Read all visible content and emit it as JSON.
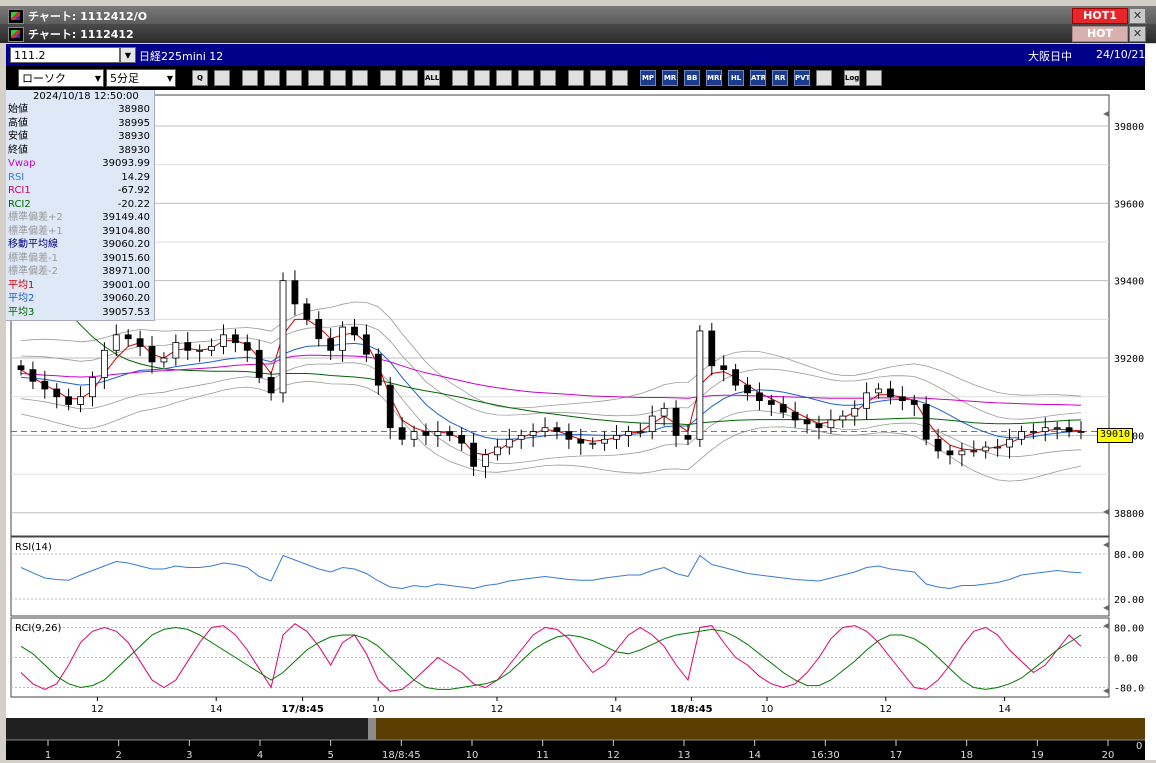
{
  "windows": {
    "outer_title": "チャート: 1112412/O",
    "inner_title": "チャート: 1112412",
    "hot_label_1": "HOT1",
    "hot_label_2": "HOT",
    "close_symbol": "✕"
  },
  "symbol_bar": {
    "code": "111.2",
    "name": "日経225mini 12",
    "market": "大阪日中",
    "date": "24/10/21"
  },
  "toolbar": {
    "chart_type": "ローソク",
    "interval": "5分足",
    "tool_icons": [
      "zoom-icon",
      "crosshair-icon",
      "pen-icon",
      "line-icon",
      "cursor-icon",
      "arrow-icon",
      "memo-icon",
      "trash-icon",
      "candle-left-icon",
      "candle-right-icon",
      "all-icon",
      "drop-icon",
      "search-chart-icon",
      "bar-chart-icon",
      "ruler-icon",
      "clock-icon",
      "gear-icon",
      "wrench-icon",
      "palette-icon",
      "mp-icon",
      "mr-icon",
      "bb-icon",
      "mre-icon",
      "hl-icon",
      "atr-icon",
      "rr-icon",
      "pvt-icon",
      "frame-icon",
      "log-icon",
      "export-icon"
    ],
    "tool_labels": [
      "Q",
      "",
      "",
      "",
      "",
      "",
      "",
      "",
      "",
      "",
      "ALL",
      "",
      "",
      "",
      "",
      "",
      "",
      "",
      "",
      "MP",
      "MR",
      "BB",
      "MRE",
      "HL",
      "ATR",
      "RR",
      "PVT",
      "",
      "Log",
      ""
    ]
  },
  "info_panel": {
    "datetime": "2024/10/18  12:50:00",
    "rows": [
      {
        "label": "始値",
        "value": "38980",
        "color": "#000000"
      },
      {
        "label": "高値",
        "value": "38995",
        "color": "#000000"
      },
      {
        "label": "安値",
        "value": "38930",
        "color": "#000000"
      },
      {
        "label": "終値",
        "value": "38930",
        "color": "#000000"
      },
      {
        "label": "Vwap",
        "value": "39093.99",
        "color": "#cc00cc"
      },
      {
        "label": "RSI",
        "value": "14.29",
        "color": "#3a7bd5"
      },
      {
        "label": "RCI1",
        "value": "-67.92",
        "color": "#cc0066"
      },
      {
        "label": "RCI2",
        "value": "-20.22",
        "color": "#006600"
      },
      {
        "label": "標準偏差+2",
        "value": "39149.40",
        "color": "#9a9a9a"
      },
      {
        "label": "標準偏差+1",
        "value": "39104.80",
        "color": "#9a9a9a"
      },
      {
        "label": "移動平均線",
        "value": "39060.20",
        "color": "#000080"
      },
      {
        "label": "標準偏差-1",
        "value": "39015.60",
        "color": "#9a9a9a"
      },
      {
        "label": "標準偏差-2",
        "value": "38971.00",
        "color": "#9a9a9a"
      },
      {
        "label": "平均1",
        "value": "39001.00",
        "color": "#cc0000"
      },
      {
        "label": "平均2",
        "value": "39060.20",
        "color": "#1f5fd0"
      },
      {
        "label": "平均3",
        "value": "39057.53",
        "color": "#006600"
      }
    ]
  },
  "price_axis": {
    "ticks": [
      "39800",
      "39600",
      "39400",
      "39200",
      "39000",
      "38800"
    ],
    "current_price_label": "39010"
  },
  "rsi_panel": {
    "title": "RSI(14)",
    "ticks": [
      "80.00",
      "20.00"
    ]
  },
  "rci_panel": {
    "title": "RCI(9,26)",
    "ticks": [
      "80.00",
      "0.00",
      "-80.00"
    ]
  },
  "time_axis": {
    "labels": [
      "12",
      "14",
      "17/8:45",
      "10",
      "12",
      "14",
      "18/8:45",
      "10",
      "12",
      "14"
    ]
  },
  "overview_axis": {
    "labels": [
      "1",
      "2",
      "3",
      "4",
      "5",
      "18/8:45",
      "10",
      "11",
      "12",
      "13",
      "14",
      "16:30",
      "17",
      "18",
      "19",
      "20"
    ],
    "right_label": "0"
  },
  "colors": {
    "vwap": "#cc00cc",
    "ma_fast": "#cc0000",
    "ma_mid": "#1f5fd0",
    "ma_slow": "#006600",
    "bands": "#9a9a9a",
    "rsi_line": "#3a7bd5",
    "rci1": "#e0006e",
    "rci2": "#007a00"
  },
  "chart_data": {
    "type": "line",
    "title": "",
    "price_range": [
      38740,
      39880
    ],
    "price_ticks": [
      38800,
      39000,
      39200,
      39400,
      39600,
      39800
    ],
    "current_price": 39010,
    "main_series": [
      {
        "name": "終値",
        "values": [
          39170,
          39140,
          39120,
          39100,
          39080,
          39100,
          39150,
          39220,
          39260,
          39250,
          39230,
          39190,
          39200,
          39240,
          39220,
          39220,
          39230,
          39260,
          39240,
          39220,
          39150,
          39110,
          39400,
          39340,
          39300,
          39250,
          39220,
          39280,
          39260,
          39210,
          39130,
          39020,
          38990,
          39010,
          39000,
          39010,
          39000,
          38980,
          38920,
          38950,
          38970,
          38990,
          39000,
          39010,
          39020,
          39010,
          38990,
          38980,
          38980,
          38990,
          39000,
          39010,
          39010,
          39050,
          39070,
          39000,
          38990,
          39270,
          39180,
          39170,
          39130,
          39110,
          39090,
          39080,
          39060,
          39040,
          39030,
          39020,
          39040,
          39050,
          39070,
          39110,
          39120,
          39100,
          39090,
          39080,
          38990,
          38960,
          38950,
          38960,
          38960,
          38970,
          38970,
          38990,
          39010,
          39010,
          39020,
          39020,
          39010,
          39010
        ]
      },
      {
        "name": "平均1",
        "values": [
          39170,
          39150,
          39130,
          39115,
          39095,
          39095,
          39115,
          39160,
          39200,
          39230,
          39240,
          39210,
          39200,
          39220,
          39225,
          39220,
          39225,
          39245,
          39245,
          39235,
          39200,
          39160,
          39260,
          39300,
          39300,
          39280,
          39250,
          39260,
          39265,
          39240,
          39180,
          39100,
          39040,
          39020,
          39010,
          39010,
          39005,
          38990,
          38955,
          38950,
          38960,
          38980,
          38995,
          39005,
          39015,
          39012,
          39000,
          38990,
          38985,
          38988,
          38995,
          39005,
          39010,
          39030,
          39050,
          39030,
          39010,
          39130,
          39160,
          39165,
          39150,
          39130,
          39110,
          39095,
          39080,
          39060,
          39045,
          39030,
          39035,
          39045,
          39060,
          39085,
          39105,
          39105,
          39098,
          39090,
          39040,
          39000,
          38975,
          38965,
          38962,
          38966,
          38970,
          38980,
          38995,
          39005,
          39012,
          39016,
          39014,
          39012
        ]
      },
      {
        "name": "平均2",
        "values": [
          39150,
          39148,
          39145,
          39140,
          39135,
          39130,
          39132,
          39140,
          39150,
          39160,
          39168,
          39170,
          39172,
          39178,
          39182,
          39186,
          39190,
          39196,
          39200,
          39202,
          39198,
          39190,
          39210,
          39222,
          39230,
          39232,
          39232,
          39236,
          39238,
          39234,
          39220,
          39190,
          39150,
          39115,
          39080,
          39055,
          39035,
          39020,
          39005,
          38995,
          38990,
          38990,
          38992,
          38995,
          38999,
          39001,
          39002,
          39002,
          39001,
          39000,
          39000,
          39002,
          39005,
          39012,
          39022,
          39025,
          39024,
          39050,
          39075,
          39095,
          39108,
          39115,
          39118,
          39116,
          39112,
          39105,
          39098,
          39090,
          39082,
          39078,
          39078,
          39082,
          39088,
          39092,
          39093,
          39092,
          39082,
          39068,
          39052,
          39035,
          39020,
          39008,
          38998,
          38994,
          38994,
          38997,
          39002,
          39006,
          39009,
          39011
        ]
      },
      {
        "name": "平均3",
        "values": [
          39480,
          39440,
          39400,
          39360,
          39320,
          39285,
          39255,
          39230,
          39210,
          39195,
          39185,
          39178,
          39172,
          39170,
          39168,
          39167,
          39166,
          39166,
          39166,
          39165,
          39162,
          39158,
          39160,
          39160,
          39160,
          39158,
          39155,
          39153,
          39151,
          39148,
          39143,
          39136,
          39128,
          39121,
          39115,
          39110,
          39104,
          39098,
          39091,
          39084,
          39078,
          39072,
          39067,
          39062,
          39058,
          39054,
          39050,
          39046,
          39042,
          39039,
          39036,
          39034,
          39032,
          39031,
          39030,
          39030,
          39028,
          39032,
          39035,
          39037,
          39039,
          39040,
          39041,
          39041,
          39041,
          39041,
          39041,
          39040,
          39040,
          39040,
          39040,
          39041,
          39042,
          39043,
          39044,
          39045,
          39044,
          39042,
          39039,
          39036,
          39033,
          39031,
          39030,
          39030,
          39031,
          39033,
          39035,
          39037,
          39039,
          39040
        ]
      },
      {
        "name": "Vwap",
        "values": [
          39160,
          39158,
          39156,
          39154,
          39152,
          39151,
          39152,
          39155,
          39158,
          39161,
          39164,
          39166,
          39167,
          39169,
          39171,
          39173,
          39175,
          39178,
          39181,
          39183,
          39184,
          39185,
          39200,
          39205,
          39207,
          39207,
          39206,
          39206,
          39205,
          39203,
          39198,
          39190,
          39180,
          39170,
          39162,
          39155,
          39148,
          39141,
          39134,
          39128,
          39123,
          39119,
          39115,
          39112,
          39110,
          39108,
          39106,
          39104,
          39102,
          39101,
          39100,
          39099,
          39098,
          39098,
          39098,
          39097,
          39096,
          39100,
          39103,
          39104,
          39104,
          39103,
          39102,
          39101,
          39100,
          39099,
          39098,
          39097,
          39096,
          39096,
          39096,
          39096,
          39097,
          39097,
          39097,
          39097,
          39096,
          39094,
          39092,
          39090,
          39088,
          39086,
          39084,
          39083,
          39082,
          39081,
          39080,
          39080,
          39079,
          39078
        ]
      }
    ],
    "rsi_range": [
      0,
      100
    ],
    "rsi_values": [
      62,
      55,
      48,
      46,
      45,
      52,
      58,
      64,
      70,
      68,
      64,
      60,
      60,
      64,
      62,
      62,
      64,
      68,
      66,
      62,
      50,
      44,
      78,
      72,
      66,
      60,
      56,
      62,
      60,
      54,
      44,
      36,
      34,
      38,
      36,
      40,
      38,
      36,
      34,
      38,
      40,
      44,
      46,
      48,
      50,
      48,
      46,
      45,
      45,
      48,
      50,
      52,
      52,
      58,
      62,
      54,
      50,
      78,
      66,
      62,
      58,
      54,
      52,
      50,
      48,
      46,
      45,
      44,
      48,
      52,
      56,
      62,
      64,
      60,
      58,
      56,
      40,
      36,
      34,
      38,
      38,
      40,
      42,
      46,
      52,
      54,
      56,
      58,
      56,
      55
    ],
    "rci_range": [
      -100,
      100
    ],
    "rci1_values": [
      -40,
      -70,
      -85,
      -70,
      -20,
      40,
      70,
      80,
      70,
      40,
      -10,
      -60,
      -80,
      -60,
      -10,
      40,
      80,
      85,
      60,
      20,
      -30,
      -80,
      60,
      90,
      70,
      30,
      -20,
      40,
      60,
      10,
      -60,
      -90,
      -85,
      -60,
      -30,
      0,
      -20,
      -40,
      -70,
      -80,
      -60,
      -20,
      20,
      60,
      80,
      75,
      50,
      0,
      -40,
      -20,
      20,
      60,
      80,
      60,
      30,
      -20,
      -60,
      80,
      85,
      40,
      0,
      -20,
      -50,
      -70,
      -80,
      -70,
      -40,
      0,
      50,
      80,
      85,
      70,
      40,
      0,
      -40,
      -80,
      -85,
      -60,
      -20,
      30,
      70,
      80,
      60,
      20,
      -10,
      -40,
      -20,
      20,
      60,
      30
    ],
    "rci2_values": [
      30,
      10,
      -20,
      -50,
      -70,
      -80,
      -75,
      -60,
      -30,
      0,
      30,
      60,
      75,
      80,
      75,
      60,
      40,
      20,
      0,
      -20,
      -40,
      -60,
      -40,
      -10,
      20,
      40,
      55,
      60,
      60,
      50,
      30,
      0,
      -30,
      -60,
      -80,
      -85,
      -85,
      -80,
      -75,
      -70,
      -60,
      -40,
      -10,
      20,
      40,
      55,
      60,
      55,
      45,
      30,
      15,
      10,
      20,
      35,
      50,
      60,
      65,
      70,
      75,
      70,
      55,
      35,
      10,
      -15,
      -40,
      -60,
      -75,
      -75,
      -60,
      -35,
      -10,
      20,
      45,
      60,
      60,
      50,
      30,
      0,
      -30,
      -60,
      -80,
      -85,
      -80,
      -70,
      -55,
      -30,
      -5,
      20,
      40,
      60
    ]
  }
}
